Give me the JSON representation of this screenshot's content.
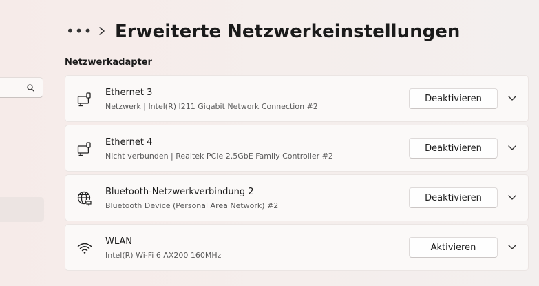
{
  "header": {
    "more_label": "•••",
    "title": "Erweiterte Netzwerkeinstellungen"
  },
  "section_title": "Netzwerkadapter",
  "adapters": [
    {
      "name": "Ethernet 3",
      "description": "Netzwerk | Intel(R) I211 Gigabit Network Connection #2",
      "button": "Deaktivieren",
      "icon": "ethernet-icon"
    },
    {
      "name": "Ethernet 4",
      "description": "Nicht verbunden | Realtek PCIe 2.5GbE Family Controller #2",
      "button": "Deaktivieren",
      "icon": "ethernet-icon"
    },
    {
      "name": "Bluetooth-Netzwerkverbindung 2",
      "description": "Bluetooth Device (Personal Area Network) #2",
      "button": "Deaktivieren",
      "icon": "globe-icon"
    },
    {
      "name": "WLAN",
      "description": "Intel(R) Wi-Fi 6 AX200 160MHz",
      "button": "Aktivieren",
      "icon": "wifi-icon"
    }
  ]
}
